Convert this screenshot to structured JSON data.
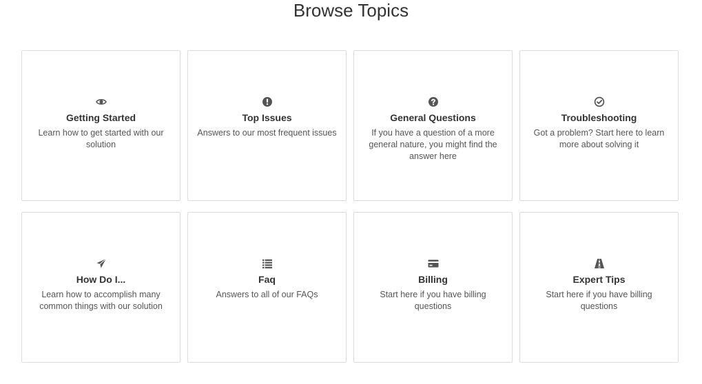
{
  "page": {
    "title": "Browse Topics"
  },
  "colors": {
    "icon": "#555555",
    "border": "#dcdcdc",
    "text": "#333333"
  },
  "topics": [
    {
      "icon": "eye-icon",
      "title": "Getting Started",
      "description": "Learn how to get started with our solution"
    },
    {
      "icon": "exclamation-circle-icon",
      "title": "Top Issues",
      "description": "Answers to our most frequent issues"
    },
    {
      "icon": "question-circle-icon",
      "title": "General Questions",
      "description": "If you have a question of a more general nature, you might find the answer here"
    },
    {
      "icon": "check-circle-icon",
      "title": "Troubleshooting",
      "description": "Got a problem? Start here to learn more about solving it"
    },
    {
      "icon": "paper-plane-icon",
      "title": "How Do I...",
      "description": "Learn how to accomplish many common things with our solution"
    },
    {
      "icon": "list-icon",
      "title": "Faq",
      "description": "Answers to all of our FAQs"
    },
    {
      "icon": "credit-card-icon",
      "title": "Billing",
      "description": "Start here if you have billing questions"
    },
    {
      "icon": "road-icon",
      "title": "Expert Tips",
      "description": "Start here if you have billing questions"
    }
  ]
}
